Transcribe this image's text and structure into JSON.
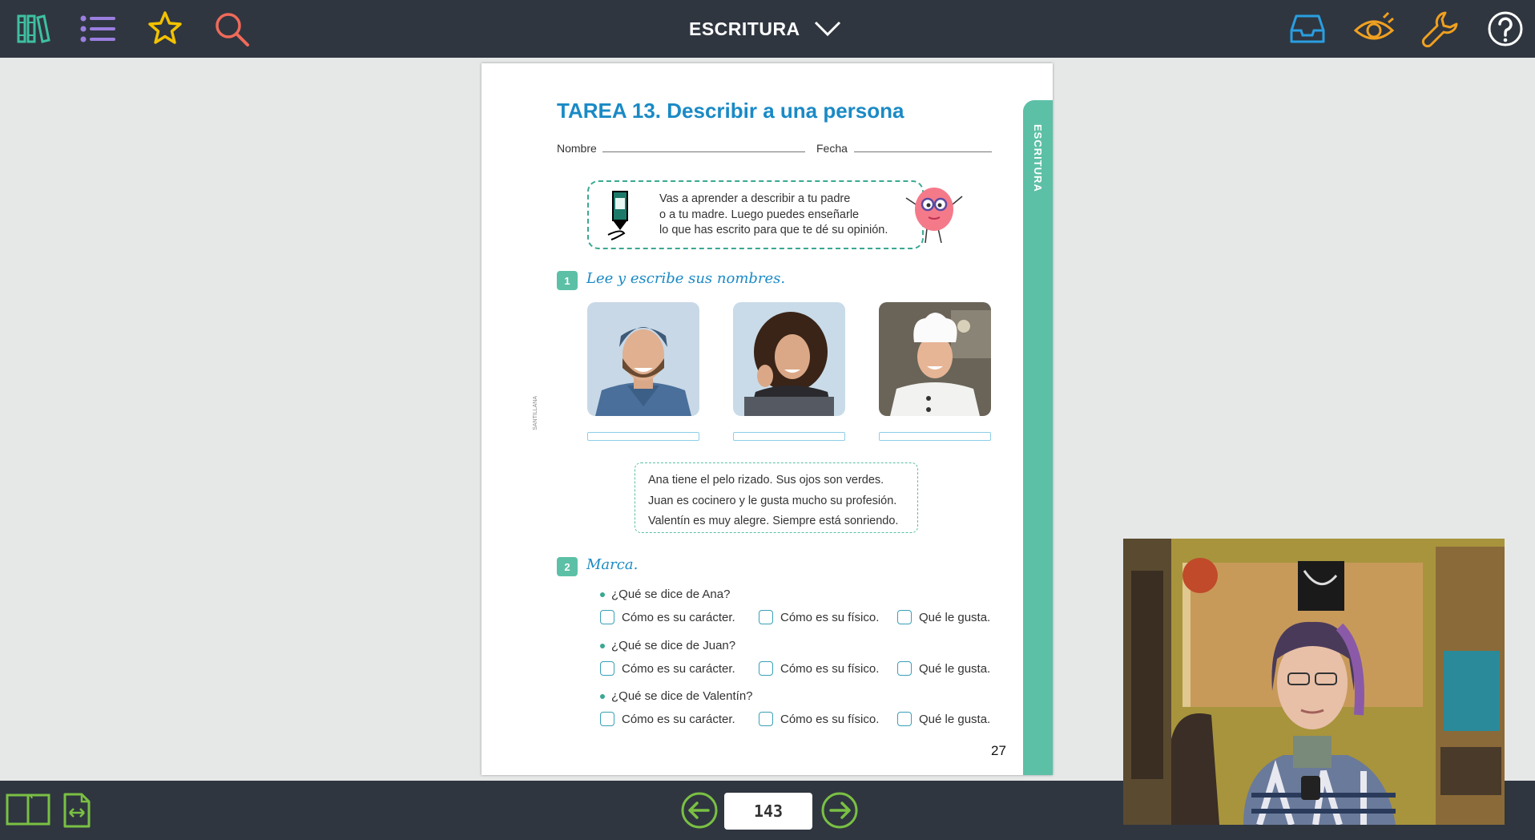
{
  "topbar": {
    "title": "ESCRITURA",
    "icons": [
      "library-icon",
      "list-icon",
      "star-icon",
      "search-icon",
      "inbox-icon",
      "eye-icon",
      "wrench-icon",
      "help-icon"
    ]
  },
  "page": {
    "title": "TAREA 13. Describir a una persona",
    "side_label": "ESCRITURA",
    "nombre_label": "Nombre",
    "fecha_label": "Fecha",
    "intro_lines": [
      "Vas a aprender a describir a tu padre",
      "o a tu madre. Luego puedes enseñarle",
      "lo que has escrito para que te dé su opinión."
    ],
    "exercise1": {
      "number": "1",
      "title": "Lee y escribe sus nombres."
    },
    "description_lines": [
      "Ana tiene el pelo rizado. Sus ojos son verdes.",
      "Juan es cocinero y le gusta mucho su profesión.",
      "Valentín es muy alegre. Siempre está sonriendo."
    ],
    "exercise2": {
      "number": "2",
      "title": "Marca."
    },
    "questions": [
      {
        "text": "¿Qué se dice de Ana?",
        "options": [
          "Cómo es su carácter.",
          "Cómo es su físico.",
          "Qué le gusta."
        ]
      },
      {
        "text": "¿Qué se dice de Juan?",
        "options": [
          "Cómo es su carácter.",
          "Cómo es su físico.",
          "Qué le gusta."
        ]
      },
      {
        "text": "¿Qué se dice de Valentín?",
        "options": [
          "Cómo es su carácter.",
          "Cómo es su físico.",
          "Qué le gusta."
        ]
      }
    ],
    "page_number": "27",
    "publisher": "SANTILLANA"
  },
  "bottombar": {
    "page_value": "143"
  },
  "colors": {
    "bar": "#2f3640",
    "accent_teal": "#5cc0a6",
    "title_blue": "#1a8ac5"
  }
}
